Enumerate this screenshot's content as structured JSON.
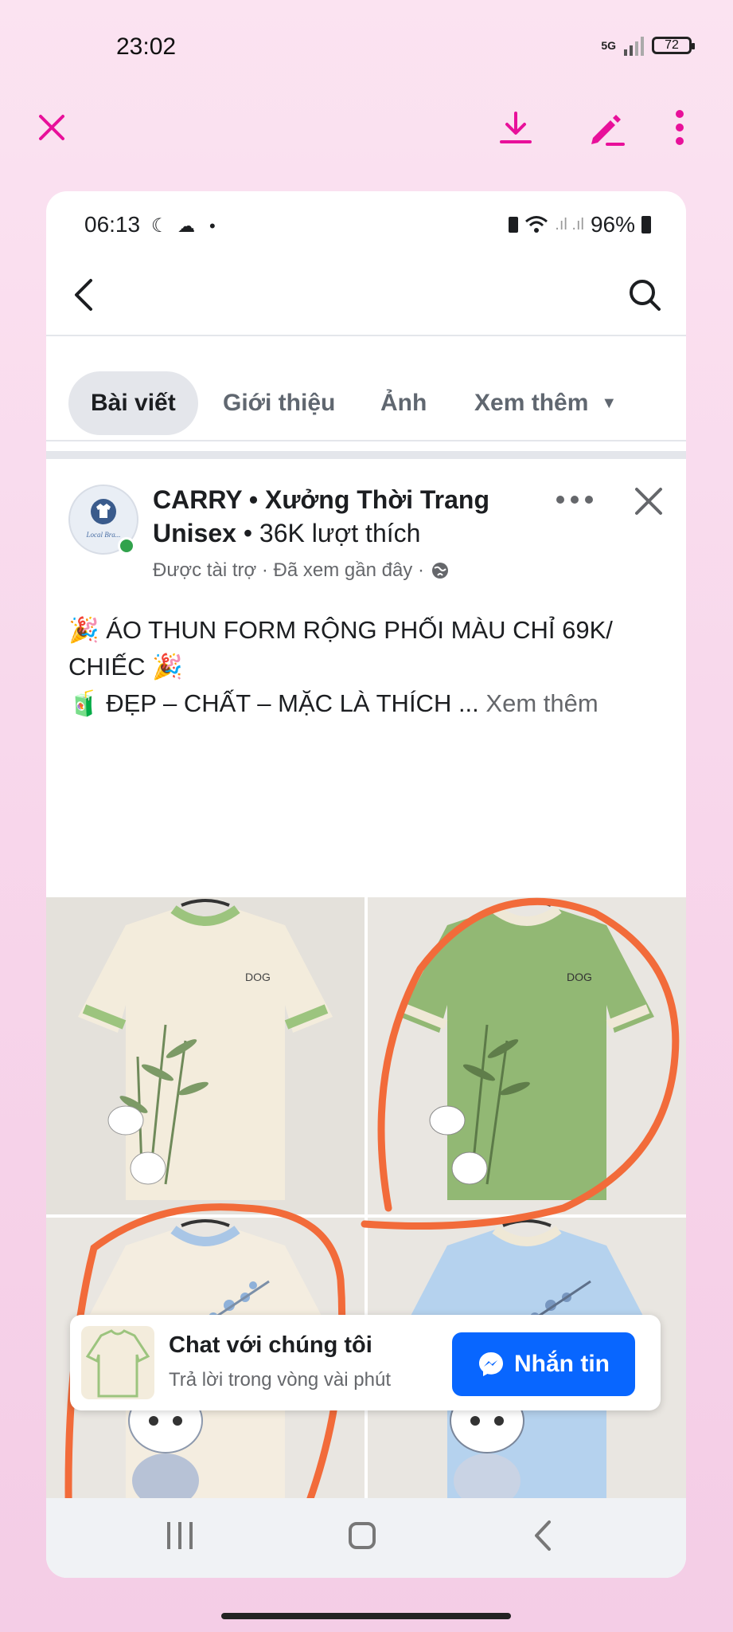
{
  "outer_status": {
    "time": "23:02",
    "network": "5G",
    "battery": "72"
  },
  "gallery_toolbar": {
    "close_icon": "close-icon",
    "download_icon": "download-icon",
    "edit_icon": "edit-icon",
    "more_icon": "more-vertical-icon",
    "accent": "#e8109a"
  },
  "inner_status": {
    "time": "06:13",
    "battery": "96%"
  },
  "tabs": [
    {
      "label": "Bài viết",
      "active": true
    },
    {
      "label": "Giới thiệu",
      "active": false
    },
    {
      "label": "Ảnh",
      "active": false
    },
    {
      "label": "Xem thêm",
      "active": false
    }
  ],
  "post": {
    "page_name": "CARRY • Xưởng Thời Trang Unisex",
    "page_name_line1": "CARRY • Xưởng Thời Trang",
    "page_name_line2": "Unisex",
    "likes": "36K lượt thích",
    "meta": "Được tài trợ · Đã xem gần đây ·",
    "line1": "🎉 ÁO THUN FORM RỘNG PHỐI MÀU CHỈ 69K/",
    "line2": "CHIẾC 🎉",
    "line3": "🧃 ĐẸP – CHẤT – MẶC LÀ THÍCH ...",
    "see_more": "Xem thêm",
    "logo_text": "Local Bra..."
  },
  "products": [
    {
      "color": "cream",
      "collar": "green",
      "body_hex": "#f3ecdc",
      "trim_hex": "#9cc47e",
      "print": "bamboo"
    },
    {
      "color": "green",
      "collar": "cream",
      "body_hex": "#92b874",
      "trim_hex": "#efe8d6",
      "print": "bamboo"
    },
    {
      "color": "cream",
      "collar": "blue",
      "body_hex": "#f4ede0",
      "trim_hex": "#a9c6e6",
      "print": "cat"
    },
    {
      "color": "blue",
      "collar": "cream",
      "body_hex": "#b5d2ee",
      "trim_hex": "#efe8d6",
      "print": "cat"
    }
  ],
  "chat_bar": {
    "title": "Chat với chúng tôi",
    "subtitle": "Trả lời trong vòng vài phút",
    "button": "Nhắn tin",
    "button_color": "#0866ff"
  },
  "annotation_color": "#f26b3a"
}
